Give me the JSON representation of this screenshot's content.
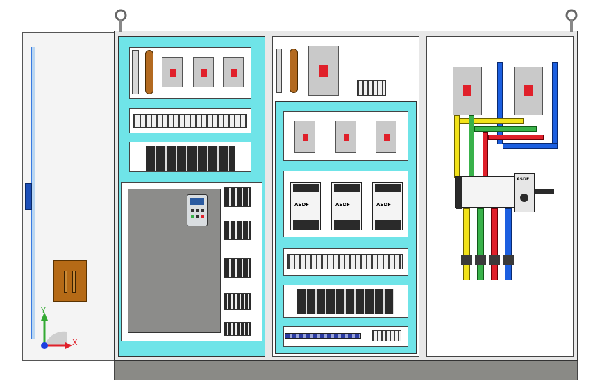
{
  "triad": {
    "x_label": "X",
    "y_label": "Y"
  },
  "colors": {
    "cyan": "#6fe4e8",
    "bus_yellow": "#f2e21a",
    "bus_green": "#39b24a",
    "bus_red": "#e0202a",
    "bus_blue": "#1c5fe0",
    "door_panel": "#f4f4f4",
    "base": "#8a8a86",
    "vfd_body": "#8c8c8a",
    "handle": "#b56a16"
  },
  "breaker_labels": [
    "ASDF",
    "ASDF",
    "ASDF"
  ],
  "switch_label": "ASDF"
}
